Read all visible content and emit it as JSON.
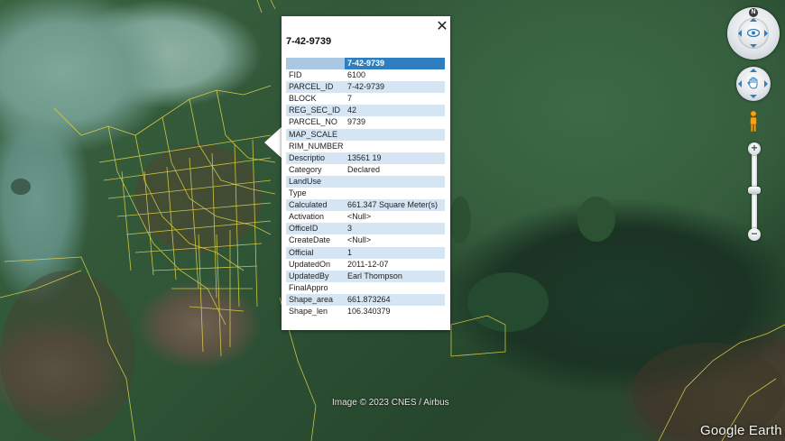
{
  "popup": {
    "title": "7-42-9739",
    "close_icon": "close-icon",
    "header_value": "7-42-9739",
    "rows": [
      {
        "key": "FID",
        "value": "6100"
      },
      {
        "key": "PARCEL_ID",
        "value": "7-42-9739"
      },
      {
        "key": "BLOCK",
        "value": "7"
      },
      {
        "key": "REG_SEC_ID",
        "value": "42"
      },
      {
        "key": "PARCEL_NO",
        "value": "9739"
      },
      {
        "key": "MAP_SCALE",
        "value": ""
      },
      {
        "key": "RIM_NUMBER",
        "value": ""
      },
      {
        "key": "Descriptio",
        "value": "13561 19"
      },
      {
        "key": "Category",
        "value": "Declared"
      },
      {
        "key": "LandUse",
        "value": ""
      },
      {
        "key": "Type",
        "value": ""
      },
      {
        "key": "Calculated",
        "value": "661.347 Square Meter(s)"
      },
      {
        "key": "Activation",
        "value": "<Null>"
      },
      {
        "key": "OfficeID",
        "value": "3"
      },
      {
        "key": "CreateDate",
        "value": "<Null>"
      },
      {
        "key": "Official",
        "value": "1"
      },
      {
        "key": "UpdatedOn",
        "value": "2011-12-07"
      },
      {
        "key": "UpdatedBy",
        "value": "Earl Thompson"
      },
      {
        "key": "FinalAppro",
        "value": ""
      },
      {
        "key": "Shape_area",
        "value": "661.873264"
      },
      {
        "key": "Shape_len",
        "value": "106.340379"
      }
    ]
  },
  "map": {
    "attribution": "Image © 2023 CNES / Airbus",
    "brand": "Google Earth",
    "parcel_line_color": "#e6d84a"
  },
  "controls": {
    "north_label": "N",
    "zoom_in": "+",
    "zoom_out": "−",
    "icons": [
      "compass-icon",
      "look-icon",
      "pan-icon",
      "pegman-icon",
      "zoom-in-icon",
      "zoom-out-icon"
    ]
  }
}
